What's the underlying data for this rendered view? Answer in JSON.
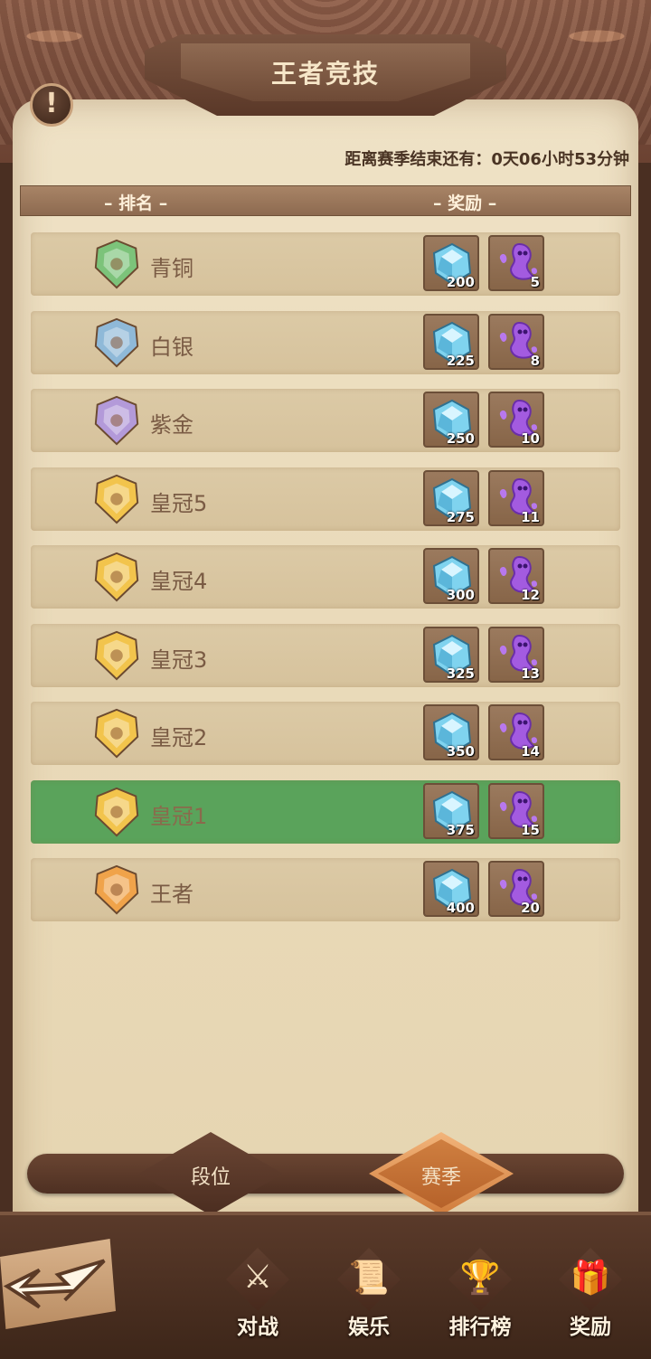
{
  "header": {
    "title": "王者竞技",
    "info_icon": "exclamation-icon",
    "countdown": "距离赛季结束还有：0天06小时53分钟"
  },
  "table": {
    "col_rank": "– 排名 –",
    "col_reward": "– 奖励 –",
    "rows": [
      {
        "rank": "青铜",
        "badge_color": "#7cc37a",
        "gem": "200",
        "soul": "5"
      },
      {
        "rank": "白银",
        "badge_color": "#8fb9d8",
        "gem": "225",
        "soul": "8"
      },
      {
        "rank": "紫金",
        "badge_color": "#b39ad9",
        "gem": "250",
        "soul": "10"
      },
      {
        "rank": "皇冠5",
        "badge_color": "#f2c44c",
        "gem": "275",
        "soul": "11"
      },
      {
        "rank": "皇冠4",
        "badge_color": "#f2c44c",
        "gem": "300",
        "soul": "12"
      },
      {
        "rank": "皇冠3",
        "badge_color": "#f2c44c",
        "gem": "325",
        "soul": "13"
      },
      {
        "rank": "皇冠2",
        "badge_color": "#f2c44c",
        "gem": "350",
        "soul": "14"
      },
      {
        "rank": "皇冠1",
        "badge_color": "#f2c44c",
        "gem": "375",
        "soul": "15"
      },
      {
        "rank": "王者",
        "badge_color": "#f0a34a",
        "gem": "400",
        "soul": "20"
      }
    ],
    "current_row_color": "#5aa35b"
  },
  "tabs": {
    "rank": "段位",
    "season": "赛季",
    "active": "season"
  },
  "nav": {
    "back_icon": "back-arrow-icon",
    "items": [
      {
        "label": "对战",
        "icon": "battle-icon"
      },
      {
        "label": "娱乐",
        "icon": "scroll-icon"
      },
      {
        "label": "排行榜",
        "icon": "trophy-icon"
      },
      {
        "label": "奖励",
        "icon": "chest-icon"
      }
    ]
  }
}
